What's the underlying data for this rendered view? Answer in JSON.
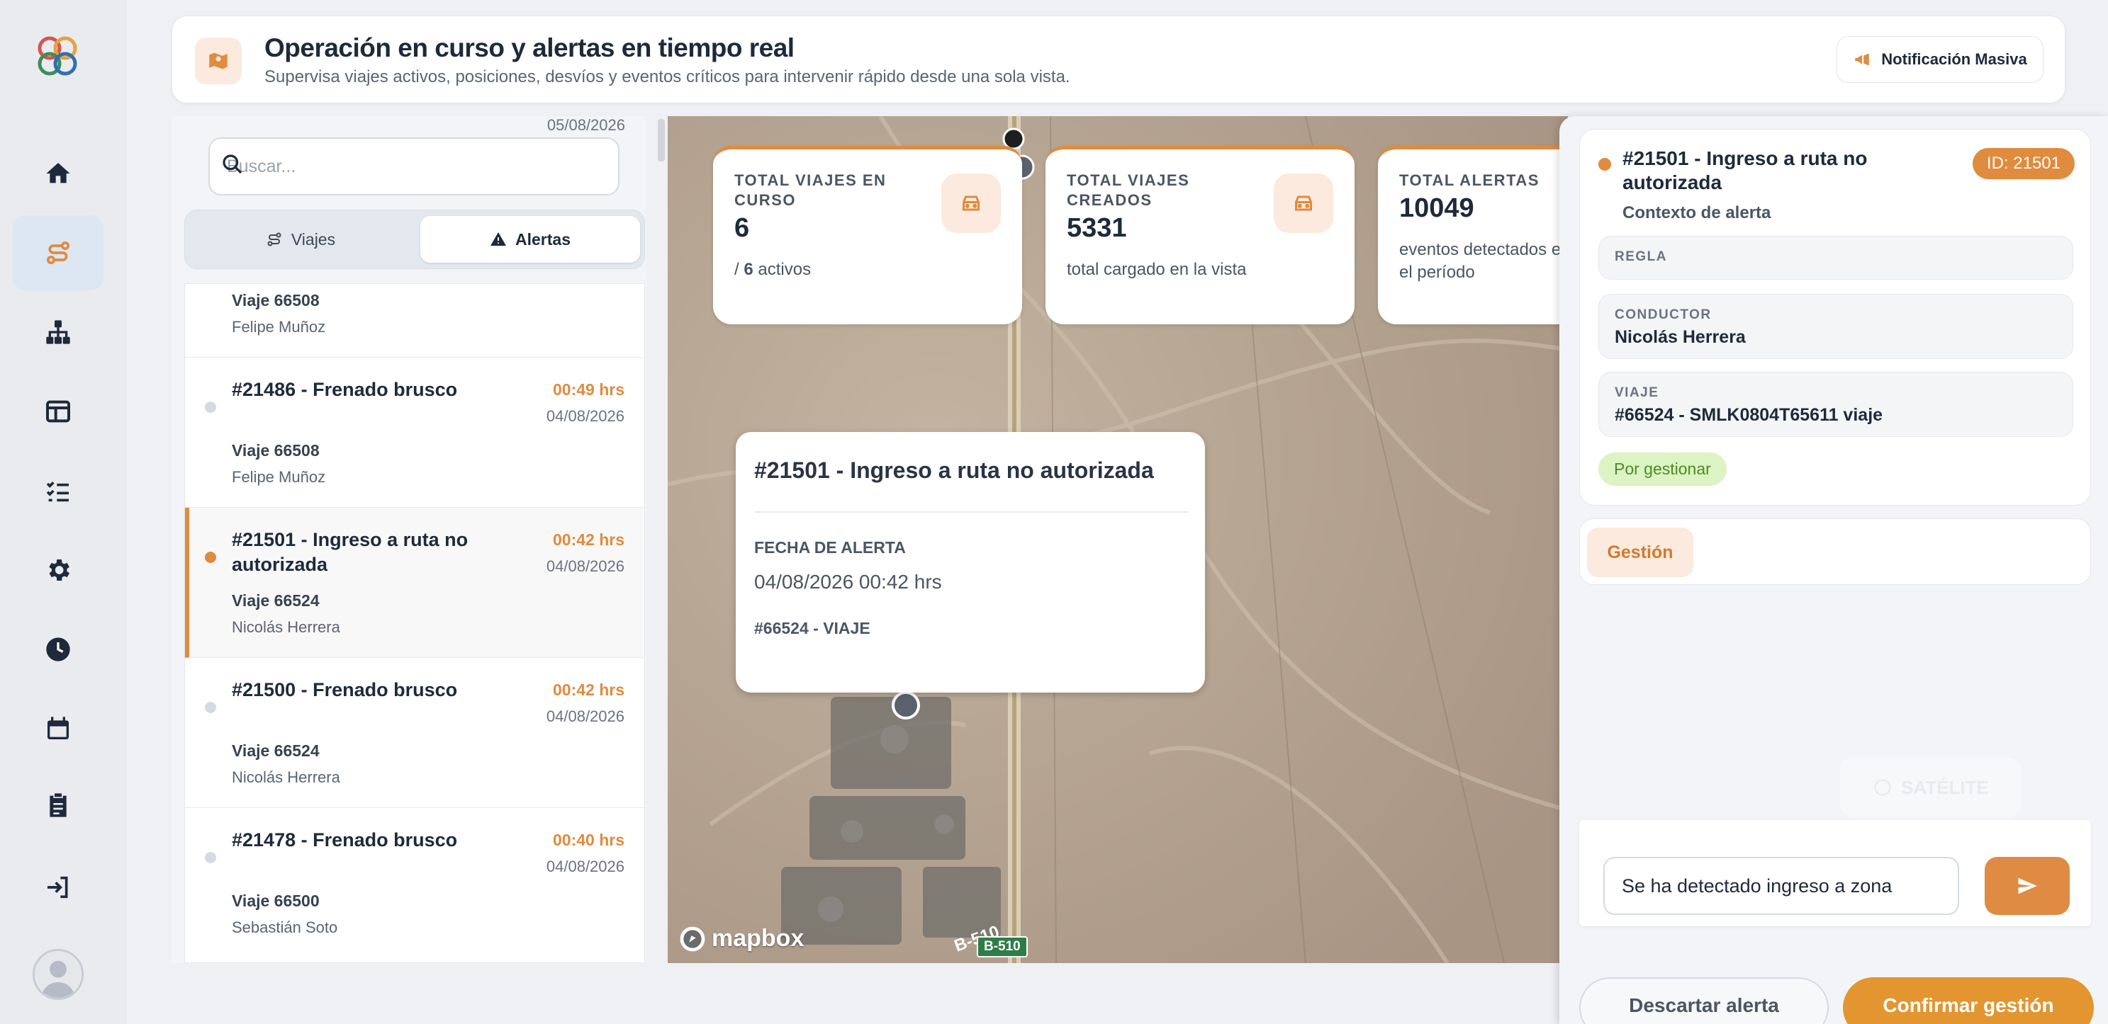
{
  "header": {
    "title": "Operación en curso y alertas en tiempo real",
    "subtitle": "Supervisa viajes activos, posiciones, desvíos y eventos críticos para intervenir rápido desde una sola vista.",
    "notify_button": "Notificación Masiva"
  },
  "sidebar": {
    "icons": [
      "logo",
      "home-icon",
      "route-icon",
      "hierarchy-icon",
      "table-icon",
      "checklist-icon",
      "gear-icon",
      "clock-icon",
      "calendar-icon",
      "clipboard-icon",
      "logout-icon",
      "avatar"
    ],
    "active": "route-icon"
  },
  "list": {
    "top_date": "05/08/2026",
    "search_placeholder": "Buscar...",
    "tabs": [
      {
        "label": "Viajes"
      },
      {
        "label": "Alertas"
      }
    ],
    "active_tab": "Alertas",
    "partial_item": {
      "trip": "Viaje 66508",
      "driver": "Felipe Muñoz"
    },
    "alerts": [
      {
        "title": "#21486 - Frenado brusco",
        "time": "00:49 hrs",
        "date": "04/08/2026",
        "trip": "Viaje 66508",
        "driver": "Felipe Muñoz"
      },
      {
        "title": "#21501 - Ingreso a ruta no autorizada",
        "time": "00:42 hrs",
        "date": "04/08/2026",
        "trip": "Viaje 66524",
        "driver": "Nicolás Herrera"
      },
      {
        "title": "#21500 - Frenado brusco",
        "time": "00:42 hrs",
        "date": "04/08/2026",
        "trip": "Viaje 66524",
        "driver": "Nicolás Herrera"
      },
      {
        "title": "#21478 - Frenado brusco",
        "time": "00:40 hrs",
        "date": "04/08/2026",
        "trip": "Viaje 66500",
        "driver": "Sebastián Soto"
      }
    ],
    "selected_index": 1
  },
  "stats": [
    {
      "label": "TOTAL VIAJES EN CURSO",
      "value": "6",
      "note_prefix": "/ ",
      "note_strong": "6",
      "note_suffix": " activos"
    },
    {
      "label": "TOTAL VIAJES CREADOS",
      "value": "5331",
      "note": "total cargado en la vista"
    },
    {
      "label": "TOTAL ALERTAS",
      "value": "10049",
      "note": "eventos detectados en el período"
    }
  ],
  "popup": {
    "title": "#21501 - Ingreso a ruta no autorizada",
    "date_label": "FECHA DE ALERTA",
    "date_value": "04/08/2026 00:42 hrs",
    "trip": "#66524 - VIAJE"
  },
  "map": {
    "attribution": "mapbox",
    "road_badge": "B-510",
    "road_label": "B-510",
    "satellite_label": "SATÉLITE"
  },
  "detail": {
    "title": "#21501 - Ingreso a ruta no autorizada",
    "id_badge": "ID: 21501",
    "subtitle": "Contexto de alerta",
    "rule_label": "REGLA",
    "rule_value": "",
    "driver_label": "CONDUCTOR",
    "driver_value": "Nicolás Herrera",
    "trip_label": "VIAJE",
    "trip_value": "#66524 - SMLK0804T65611 viaje",
    "status": "Por gestionar",
    "gestion_tab": "Gestión",
    "message_value": "Se ha detectado ingreso a zona",
    "discard_button": "Descartar alerta",
    "confirm_button": "Confirmar gestión"
  },
  "colors": {
    "accent": "#e08b3e",
    "confirm": "#e3952f",
    "status_bg": "#dcf3c3",
    "status_text": "#4e8b24",
    "sidebar_bg": "#e9ebef",
    "nav_icon": "#1e2a3b"
  }
}
